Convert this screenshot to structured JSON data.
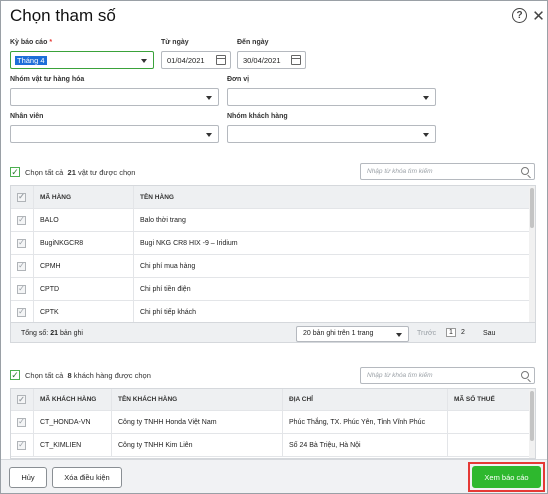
{
  "dialog": {
    "title": "Chọn tham số"
  },
  "filters": {
    "report_period": {
      "label": "Kỳ báo cáo",
      "required_mark": "*",
      "value": "Tháng 4"
    },
    "from_date": {
      "label": "Từ ngày",
      "value": "01/04/2021"
    },
    "to_date": {
      "label": "Đến ngày",
      "value": "30/04/2021"
    },
    "item_group": {
      "label": "Nhóm vật tư hàng hóa",
      "value": ""
    },
    "unit": {
      "label": "Đơn vị",
      "value": ""
    },
    "employee": {
      "label": "Nhân viên",
      "value": ""
    },
    "customer_group": {
      "label": "Nhóm khách hàng",
      "value": ""
    }
  },
  "items_section": {
    "select_all_label": "Chọn tất cả",
    "selected_count": "21",
    "selected_suffix": "vật tư được chọn",
    "search_placeholder": "Nhập từ khóa tìm kiếm",
    "columns": [
      "MÃ HÀNG",
      "TÊN HÀNG"
    ],
    "rows": [
      {
        "code": "BALO",
        "name": "Balo thời trang"
      },
      {
        "code": "BugiNKGCR8",
        "name": "Bugi NKG CR8 HIX -9 – Iridium"
      },
      {
        "code": "CPMH",
        "name": "Chi phí mua hàng"
      },
      {
        "code": "CPTD",
        "name": "Chi phí tiền điện"
      },
      {
        "code": "CPTK",
        "name": "Chi phí tiếp khách"
      }
    ],
    "total_label": "Tổng số:",
    "total_value": "21",
    "total_suffix": "bản ghi",
    "page_size": "20 bản ghi trên 1 trang",
    "prev_label": "Trước",
    "pages": [
      "1",
      "2"
    ],
    "next_label": "Sau"
  },
  "customers_section": {
    "select_all_label": "Chọn tất cả",
    "selected_count": "8",
    "selected_suffix": "khách hàng được chọn",
    "search_placeholder": "Nhập từ khóa tìm kiếm",
    "columns": [
      "MÃ KHÁCH HÀNG",
      "TÊN KHÁCH HÀNG",
      "ĐỊA CHỈ",
      "MÃ SỐ THUẾ"
    ],
    "rows": [
      {
        "code": "CT_HONDA-VN",
        "name": "Công ty TNHH Honda Việt Nam",
        "address": "Phúc Thắng, TX. Phúc Yên, Tỉnh Vĩnh Phúc",
        "tax": ""
      },
      {
        "code": "CT_KIMLIEN",
        "name": "Công ty TNHH Kim Liên",
        "address": "Số 24 Bà Triệu, Hà Nội",
        "tax": ""
      }
    ]
  },
  "buttons": {
    "cancel": "Hủy",
    "clear": "Xóa điều kiện",
    "view_report": "Xem báo cáo"
  },
  "colors": {
    "accent": "#2eb82e",
    "highlight": "#e53935",
    "selection": "#1e6fd9"
  }
}
